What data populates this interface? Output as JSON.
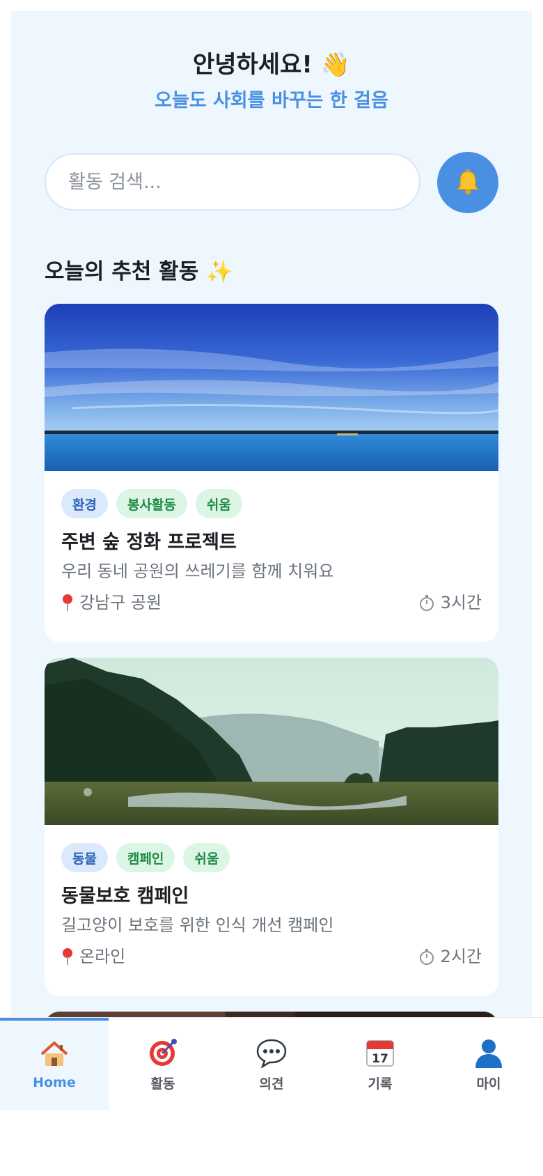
{
  "header": {
    "greeting": "안녕하세요! 👋",
    "subtitle": "오늘도 사회를 바꾸는 한 걸음"
  },
  "search": {
    "placeholder": "활동 검색..."
  },
  "section": {
    "title": "오늘의 추천 활동 ✨"
  },
  "cards": [
    {
      "image": "lake-sunset-landscape",
      "tags": [
        "환경",
        "봉사활동",
        "쉬움"
      ],
      "title": "주변 숲 정화 프로젝트",
      "description": "우리 동네 공원의 쓰레기를 함께 치워요",
      "location": "강남구 공원",
      "duration": "3시간"
    },
    {
      "image": "forest-river-landscape",
      "tags": [
        "동물",
        "캠페인",
        "쉬움"
      ],
      "title": "동물보호 캠페인",
      "description": "길고양이 보호를 위한 인식 개선 캠페인",
      "location": "온라인",
      "duration": "2시간"
    }
  ],
  "tabbar": {
    "items": [
      {
        "label": "Home",
        "icon": "house-icon",
        "active": true
      },
      {
        "label": "활동",
        "icon": "target-icon",
        "active": false
      },
      {
        "label": "의견",
        "icon": "speech-bubble-icon",
        "active": false
      },
      {
        "label": "기록",
        "icon": "calendar-icon",
        "active": false
      },
      {
        "label": "마이",
        "icon": "person-icon",
        "active": false
      }
    ]
  },
  "colors": {
    "accent": "#4a90e2",
    "background": "#eef6fe",
    "tag_blue_bg": "#dbe9fc",
    "tag_green_bg": "#dcf5e4"
  }
}
